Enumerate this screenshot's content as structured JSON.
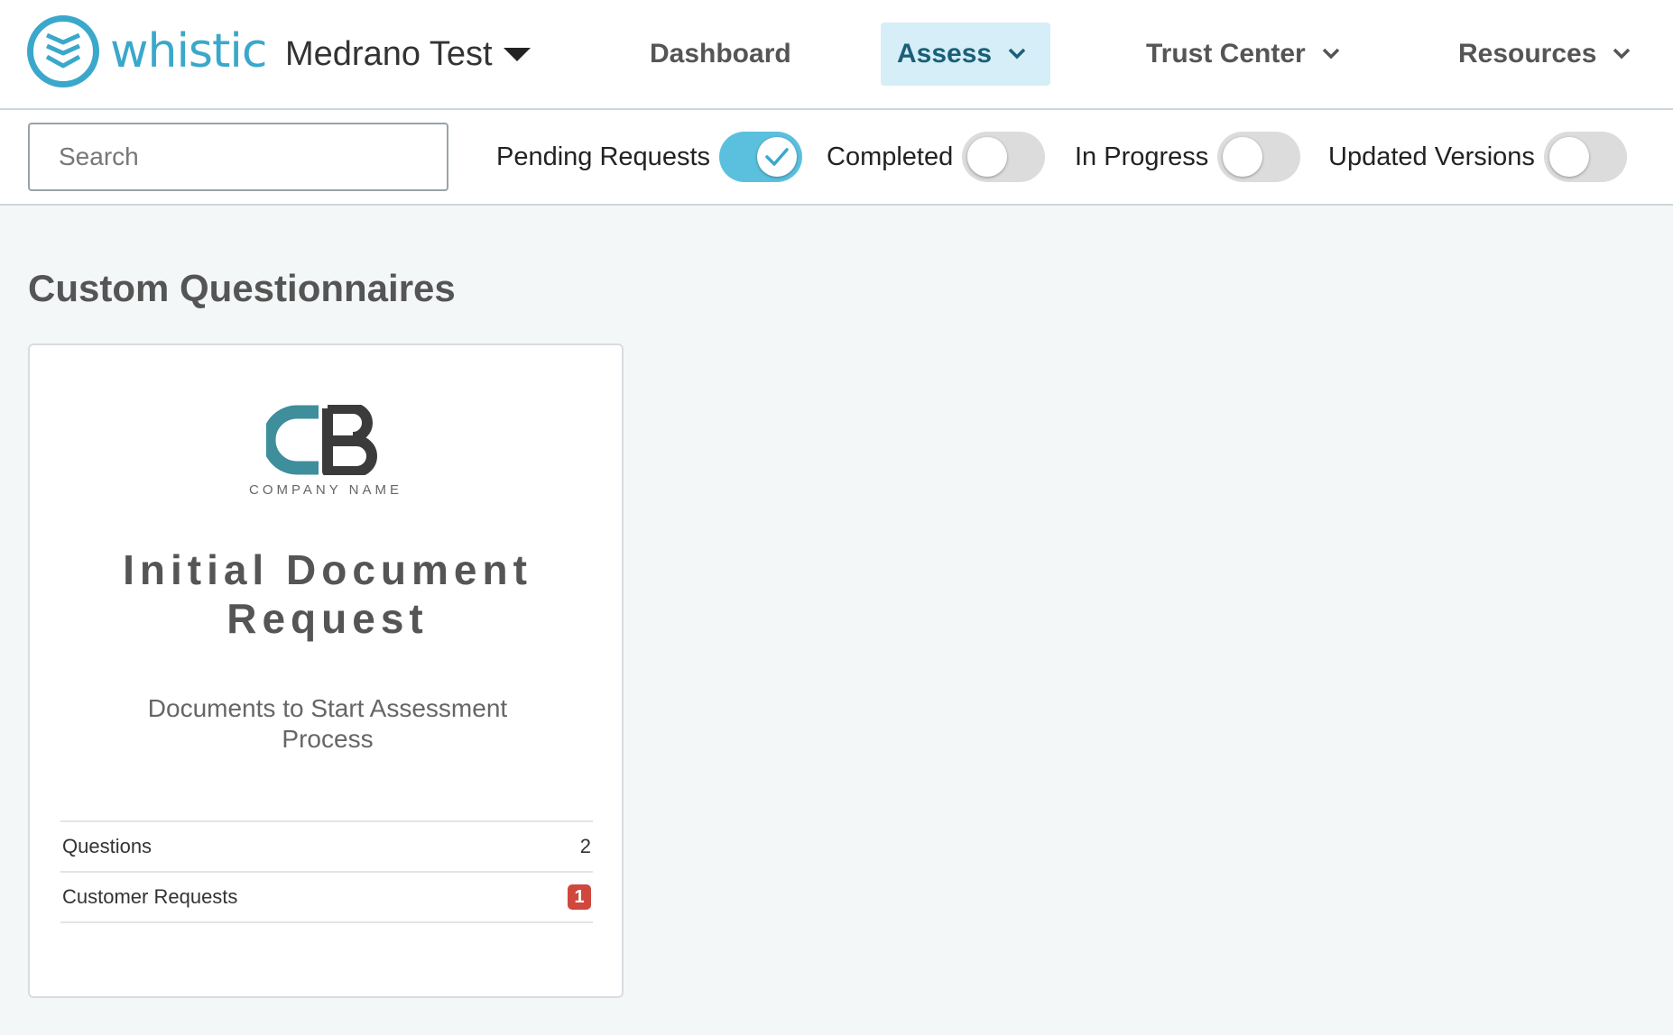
{
  "header": {
    "logo_text": "whistic",
    "org_name": "Medrano Test",
    "nav": [
      {
        "label": "Dashboard"
      },
      {
        "label": "Assess"
      },
      {
        "label": "Trust Center"
      },
      {
        "label": "Resources"
      }
    ],
    "active_nav": "Assess",
    "brand_color": "#3aa8cb"
  },
  "filters": {
    "search_placeholder": "Search",
    "toggles": [
      {
        "label": "Pending Requests",
        "on": true
      },
      {
        "label": "Completed",
        "on": false
      },
      {
        "label": "In Progress",
        "on": false
      },
      {
        "label": "Updated Versions",
        "on": false
      }
    ],
    "toggle_on_color": "#5bc0de"
  },
  "main": {
    "section_title": "Custom Questionnaires",
    "cards": [
      {
        "logo_letters": "CB",
        "logo_caption": "COMPANY NAME",
        "title": "Initial Document Request",
        "description": "Documents to Start Assessment Process",
        "stats": [
          {
            "label": "Questions",
            "value": "2"
          },
          {
            "label": "Customer Requests",
            "value": "1"
          }
        ]
      }
    ]
  }
}
